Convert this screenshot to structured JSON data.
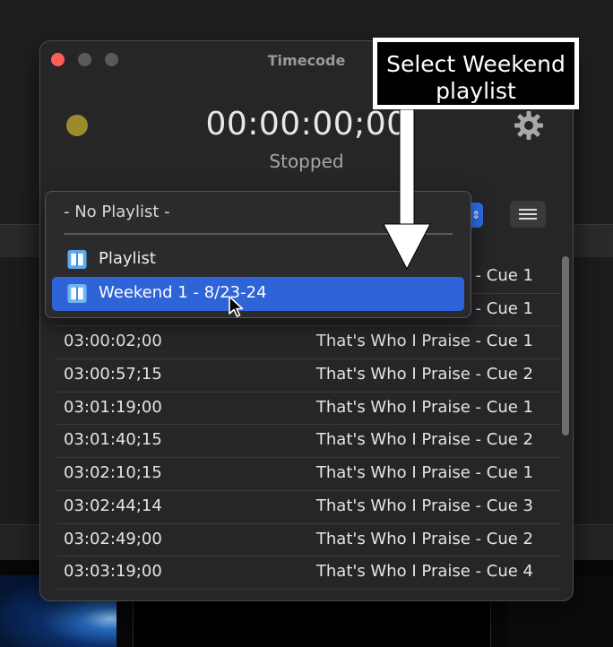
{
  "window": {
    "title": "Timecode",
    "timecode": "00:00:00;00",
    "state": "Stopped",
    "status_color": "#9d8a2a"
  },
  "menu": {
    "none_label": "- No Playlist -",
    "items": [
      {
        "label": "Playlist",
        "icon": "book-icon",
        "selected": false
      },
      {
        "label": "Weekend 1 - 8/23-24",
        "icon": "book-icon",
        "selected": true
      }
    ]
  },
  "cue_list": {
    "rows": [
      {
        "time": "",
        "cue": "- Cue 1"
      },
      {
        "time": "",
        "cue": "- Cue 1"
      },
      {
        "time": "03:00:02;00",
        "cue": "That's Who I Praise - Cue 1"
      },
      {
        "time": "03:00:57;15",
        "cue": "That's Who I Praise - Cue 2"
      },
      {
        "time": "03:01:19;00",
        "cue": "That's Who I Praise - Cue 1"
      },
      {
        "time": "03:01:40;15",
        "cue": "That's Who I Praise - Cue 2"
      },
      {
        "time": "03:02:10;15",
        "cue": "That's Who I Praise - Cue 1"
      },
      {
        "time": "03:02:44;14",
        "cue": "That's Who I Praise - Cue 3"
      },
      {
        "time": "03:02:49;00",
        "cue": "That's Who I Praise - Cue 2"
      },
      {
        "time": "03:03:19;00",
        "cue": "That's Who I Praise - Cue 4"
      }
    ]
  },
  "annotation": {
    "line1": "Select Weekend",
    "line2": "playlist"
  },
  "colors": {
    "accent": "#2f63d8",
    "close": "#ff5f57"
  }
}
